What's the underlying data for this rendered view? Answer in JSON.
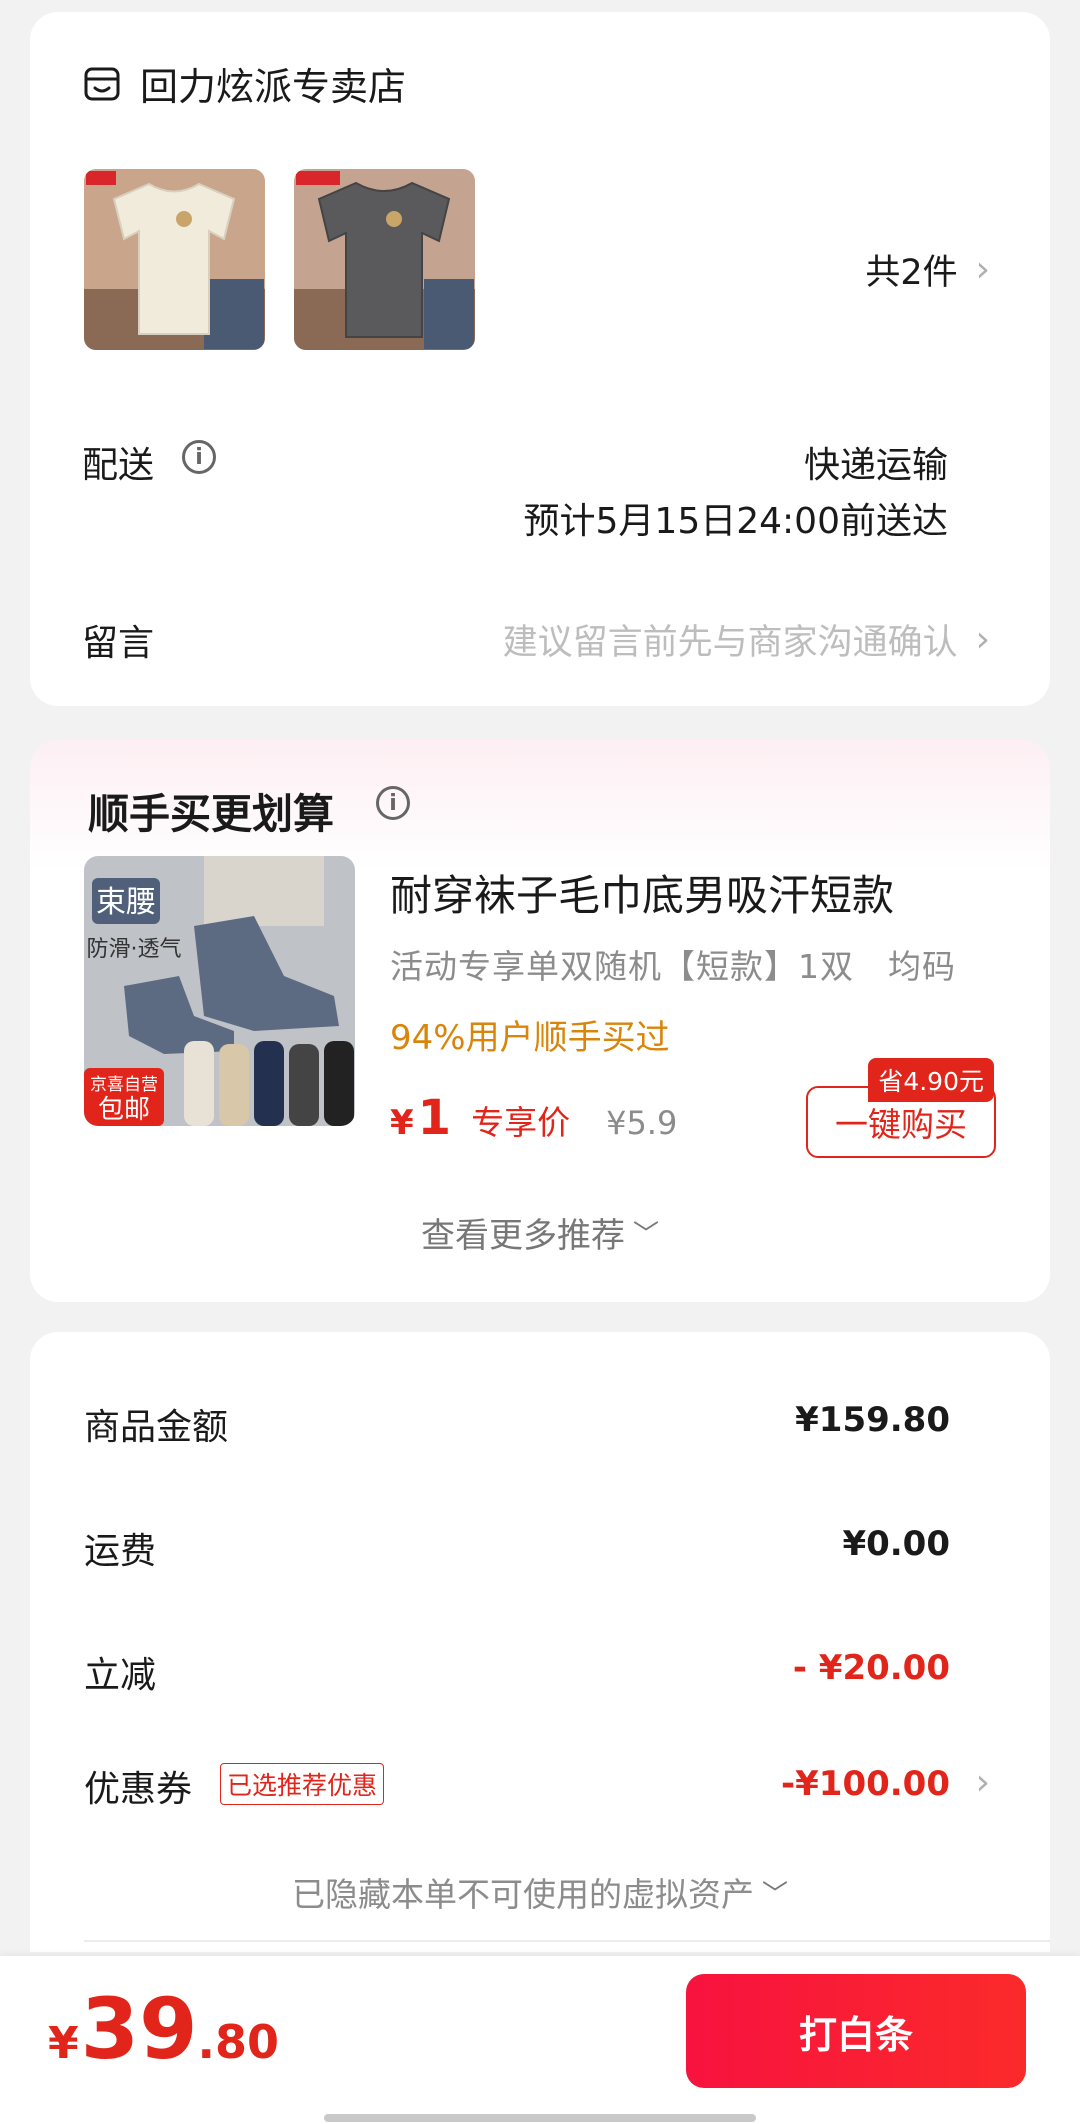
{
  "store": {
    "icon": "store-icon",
    "name": "回力炫派专卖店",
    "item_count": "共2件",
    "chevron": "›"
  },
  "delivery": {
    "label": "配送",
    "info_icon": "info-icon",
    "method": "快递运输",
    "eta": "预计5月15日24:00前送达"
  },
  "message": {
    "label": "留言",
    "placeholder": "建议留言前先与商家沟通确认",
    "chevron": "›"
  },
  "recommend": {
    "title": "顺手买更划算",
    "product_name": "耐穿袜子毛巾底男吸汗短款",
    "spec": "活动专享单双随机【短款】1双　均码",
    "social_proof": "94%用户顺手买过",
    "price_symbol": "¥",
    "price": "1",
    "price_tag": "专享价",
    "original_price": "¥5.9",
    "save_badge": "省4.90元",
    "buy_button": "一键购买",
    "more": "查看更多推荐",
    "thumb_text": {
      "brand": "束腰",
      "feature": "防滑·透气",
      "badge_top": "京喜自营",
      "badge_bottom": "包邮"
    }
  },
  "summary": {
    "rows": [
      {
        "label": "商品金额",
        "value": "¥159.80"
      },
      {
        "label": "运费",
        "value": "¥0.00"
      },
      {
        "label": "立减",
        "value": "- ¥20.00"
      },
      {
        "label": "优惠券",
        "value": "-¥100.00"
      }
    ],
    "coupon_tag": "已选推荐优惠",
    "hidden_assets": "已隐藏本单不可使用的虚拟资产"
  },
  "footer": {
    "currency": "¥",
    "total_integer": "39",
    "total_decimal": ".80",
    "pay_button": "打白条"
  },
  "colors": {
    "accent": "#e1251b",
    "gold": "#d9850b",
    "pay_button": "#f8123f"
  }
}
